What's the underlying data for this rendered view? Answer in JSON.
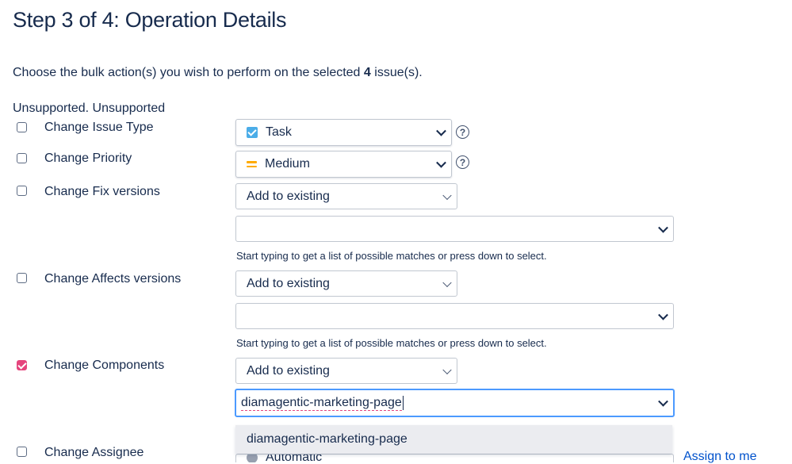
{
  "page": {
    "title": "Step 3 of 4: Operation Details",
    "intro_before": "Choose the bulk action(s) you wish to perform on the selected ",
    "issue_count": "4",
    "intro_after": " issue(s).",
    "unsupported": "Unsupported. Unsupported"
  },
  "rows": {
    "issue_type": {
      "label": "Change Issue Type",
      "checked": false,
      "value": "Task",
      "help": "?"
    },
    "priority": {
      "label": "Change Priority",
      "checked": false,
      "value": "Medium",
      "help": "?"
    },
    "fix_versions": {
      "label": "Change Fix versions",
      "checked": false,
      "mode": "Add to existing",
      "value": "",
      "hint": "Start typing to get a list of possible matches or press down to select."
    },
    "affects_versions": {
      "label": "Change Affects versions",
      "checked": false,
      "mode": "Add to existing",
      "value": "",
      "hint": "Start typing to get a list of possible matches or press down to select."
    },
    "components": {
      "label": "Change Components",
      "checked": true,
      "mode": "Add to existing",
      "value": "diamagentic-marketing-page",
      "suggestion": "diamagentic-marketing-page"
    },
    "assignee": {
      "label": "Change Assignee",
      "checked": false,
      "value": "Automatic",
      "assign_link": "Assign to me"
    }
  },
  "colors": {
    "accent_checkbox": "#e5457d",
    "focus_border": "#4c9aff",
    "link": "#0052cc",
    "task_icon": "#4bade8",
    "priority_medium": "#ffab00"
  }
}
